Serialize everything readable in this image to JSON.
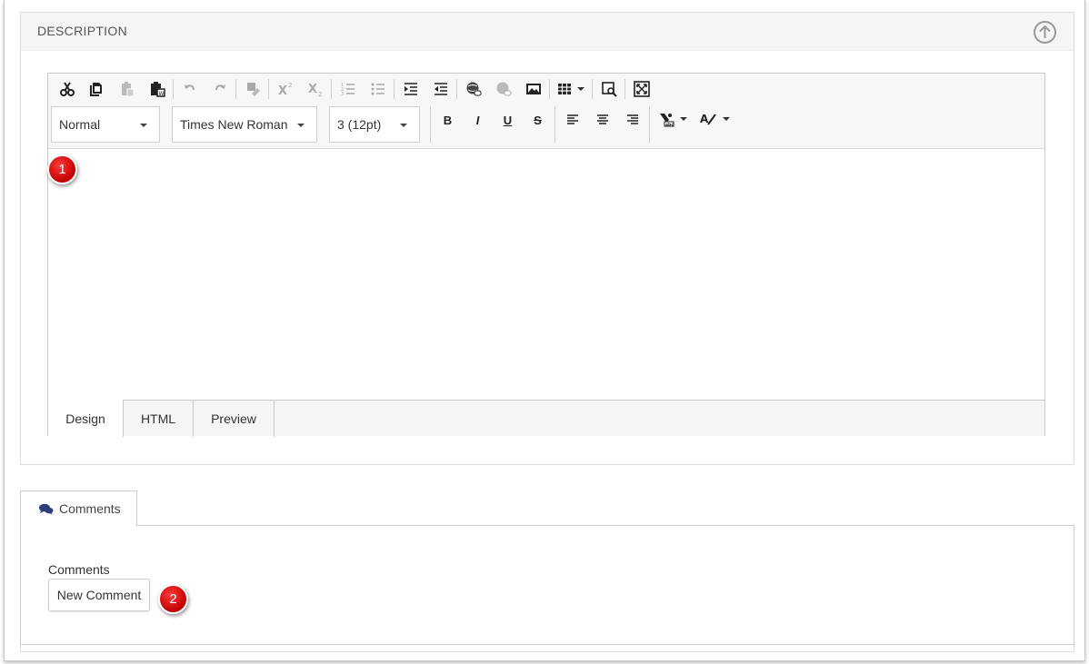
{
  "description_panel": {
    "title": "DESCRIPTION",
    "collapse_icon": "arrow-up-circle-icon"
  },
  "editor": {
    "toolbar_row1": [
      {
        "name": "cut-icon",
        "enabled": true
      },
      {
        "name": "copy-icon",
        "enabled": true
      },
      {
        "name": "paste-icon",
        "enabled": false
      },
      {
        "name": "paste-from-word-icon",
        "enabled": true
      },
      {
        "name": "undo-icon",
        "enabled": false
      },
      {
        "name": "redo-icon",
        "enabled": false
      },
      {
        "name": "format-stripper-icon",
        "enabled": false
      },
      {
        "name": "superscript-icon",
        "enabled": false
      },
      {
        "name": "subscript-icon",
        "enabled": false
      },
      {
        "name": "ordered-list-icon",
        "enabled": false
      },
      {
        "name": "unordered-list-icon",
        "enabled": false
      },
      {
        "name": "indent-icon",
        "enabled": true
      },
      {
        "name": "outdent-icon",
        "enabled": true
      },
      {
        "name": "insert-link-icon",
        "enabled": true
      },
      {
        "name": "remove-link-icon",
        "enabled": false
      },
      {
        "name": "insert-image-icon",
        "enabled": true
      },
      {
        "name": "insert-table-icon",
        "enabled": true
      },
      {
        "name": "find-icon",
        "enabled": true
      },
      {
        "name": "fullscreen-icon",
        "enabled": true
      }
    ],
    "paragraph_style": "Normal",
    "font_name": "Times New Roman",
    "font_size": "3 (12pt)",
    "format_buttons": {
      "bold": "B",
      "italic": "I",
      "underline": "U",
      "strikethrough": "S"
    },
    "mode_tabs": [
      "Design",
      "HTML",
      "Preview"
    ],
    "active_mode": "Design"
  },
  "comments": {
    "tab_label": "Comments",
    "tab_icon": "comments-icon",
    "section_label": "Comments",
    "new_comment_label": "New Comment"
  },
  "annotations": {
    "badge1": "1",
    "badge2": "2",
    "badge_color": "#d40000"
  }
}
